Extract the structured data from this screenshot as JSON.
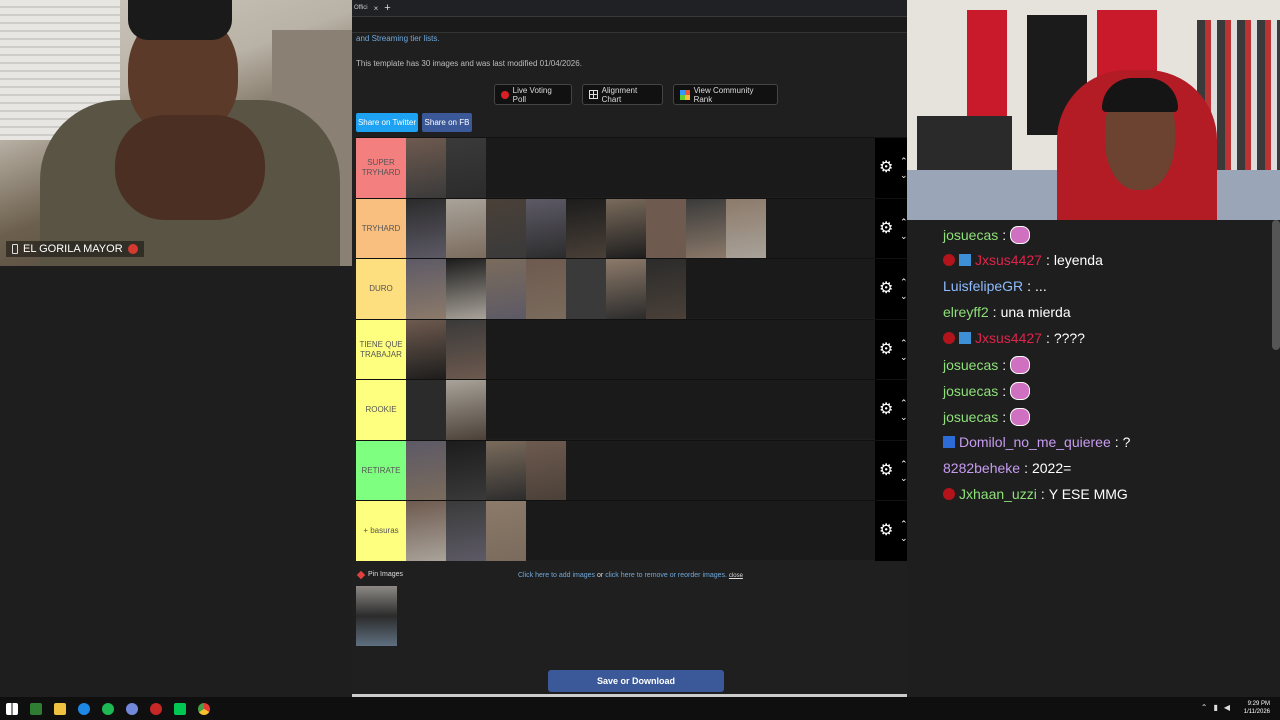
{
  "left_cam": {
    "name": "EL GORILA MAYOR"
  },
  "browser": {
    "tab_title": "Offici",
    "tab_close": "×",
    "new_tab": "+"
  },
  "tierlist": {
    "description_link": "and Streaming tier lists.",
    "template_info": "This template has 30 images and was last modified 01/04/2026.",
    "buttons": {
      "live_poll": "Live Voting Poll",
      "alignment": "Alignment Chart",
      "community": "View Community Rank",
      "share_twitter": "Share on Twitter",
      "share_fb": "Share on FB"
    },
    "tiers": [
      {
        "label": "SUPER TRYHARD",
        "color": "#f47f7f",
        "image_count": 2
      },
      {
        "label": "TRYHARD",
        "color": "#f9bf7f",
        "image_count": 9
      },
      {
        "label": "DURO",
        "color": "#fddf7f",
        "image_count": 7
      },
      {
        "label": "TIENE QUE TRABAJAR",
        "color": "#ffff7f",
        "image_count": 2
      },
      {
        "label": "ROOKIE",
        "color": "#ffff7f",
        "image_count": 2
      },
      {
        "label": "RETIRATE",
        "color": "#7fff7f",
        "image_count": 4
      },
      {
        "label": "+ basuras",
        "color": "#ffff7f",
        "image_count": 3
      }
    ],
    "gear": "⚙",
    "up_arrow": "⌃",
    "down_arrow": "⌄",
    "pin_images": "Pin Images",
    "add_images_link": "Click here to add images",
    "or": "or",
    "remove_link": "click here to remove or reorder images.",
    "close": "close",
    "save_button": "Save or Download"
  },
  "chat": {
    "messages": [
      {
        "user": "josuecas",
        "text": "",
        "user_color": "#8ee07a",
        "emote": true,
        "badges": []
      },
      {
        "user": "Jxsus4427",
        "text": "leyenda",
        "user_color": "#e0234a",
        "emote": false,
        "badges": [
          "red",
          "gift"
        ]
      },
      {
        "user": "LuisfelipeGR",
        "text": "...",
        "user_color": "#8fbcff",
        "emote": false,
        "badges": []
      },
      {
        "user": "elreyff2",
        "text": "una mierda",
        "user_color": "#8ee07a",
        "emote": false,
        "badges": []
      },
      {
        "user": "Jxsus4427",
        "text": "????",
        "user_color": "#e0234a",
        "emote": false,
        "badges": [
          "red",
          "gift"
        ]
      },
      {
        "user": "josuecas",
        "text": "",
        "user_color": "#8ee07a",
        "emote": true,
        "badges": []
      },
      {
        "user": "josuecas",
        "text": "",
        "user_color": "#8ee07a",
        "emote": true,
        "badges": []
      },
      {
        "user": "josuecas",
        "text": "",
        "user_color": "#8ee07a",
        "emote": true,
        "badges": []
      },
      {
        "user": "Domilol_no_me_quieree",
        "text": "?",
        "user_color": "#c79cf0",
        "emote": false,
        "badges": [
          "blue"
        ]
      },
      {
        "user": "8282beheke",
        "text": "2022=",
        "user_color": "#c79cf0",
        "emote": false,
        "badges": []
      },
      {
        "user": "Jxhaan_uzzi",
        "text": "Y ESE MMG",
        "user_color": "#8ee07a",
        "emote": false,
        "badges": [
          "red"
        ]
      }
    ]
  },
  "taskbar": {
    "time": "9:29 PM",
    "date": "1/11/2026"
  }
}
